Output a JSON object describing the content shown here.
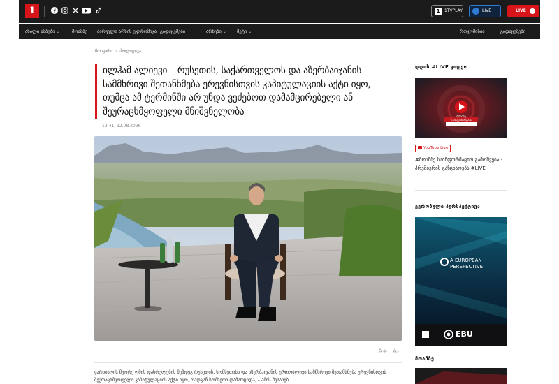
{
  "header": {
    "logo": "1",
    "social_icons": [
      "facebook-icon",
      "instagram-icon",
      "x-icon",
      "youtube-icon",
      "tiktok-icon"
    ],
    "btn_1tv_label": "1TVPLAY",
    "btn_live_blue_label": "LIVE",
    "btn_live_red_label": "LIVE"
  },
  "nav": {
    "left": [
      {
        "label": "ახალი ამბები",
        "has_menu": true
      },
      {
        "label": "მოამბე",
        "has_menu": false
      },
      {
        "label": "პირველი არხის ეკონომიკა",
        "has_menu": false
      },
      {
        "label": "გადაცემები",
        "has_menu": false
      },
      {
        "label": "არხები",
        "has_menu": true
      },
      {
        "label": "მეტი",
        "has_menu": true
      }
    ],
    "right": [
      {
        "label": "როკომისია"
      },
      {
        "label": "გადაცემები"
      }
    ]
  },
  "breadcrumb": {
    "home": "მთავარი",
    "current": "პოლიტიკა"
  },
  "article": {
    "headline": "ილჰამ ალიევი – რუსეთის, საქართველოს და აზერბაიჯანის სამმხრივი შეთანხმება ერევნისთვის კაპიტულაციის აქტი იყო, თუმცა ამ ტერმინში არ უნდა ვეძებოთ დამამცირებელი ან შეურაცხმყოფელი მნიშვნელობა",
    "timestamp": "13:41, 12.08.2026",
    "font_up": "A+",
    "font_down": "A-",
    "body": "ყარაბაღის მეორე ომის დასრულების შემდეგ რუსეთის, სომხეთისა და აზერბაიჯანის ერთობლივი სამმხრივი შეთანხმება ერევნისთვის შეურაცხმყოფელი კაპიტულაციის აქტი იყო, რადგან სომხეთი დამარცხდა, – ამის შესახებ"
  },
  "sidebar": {
    "live_title": "დღის #LIVE ვიდეო",
    "live_thumb_text": "მოამბე საინფორმაციო გამოშვება",
    "youtube_badge": "YouTube Live",
    "live_caption": "#მოამბე საინფორმაციო გამოშვება - პრემიერის განცხადება #LIVE",
    "euro_title": "ევროპული პერსპექტივა",
    "euro_thumb_brand": "A EUROPEAN PERSPECTIVE",
    "euro_ebu": "EBU",
    "moambe_title": "მოამბე"
  },
  "colors": {
    "accent": "#d7141a",
    "dark_bar": "#1b1b1b",
    "blue": "#2f7bd4"
  }
}
